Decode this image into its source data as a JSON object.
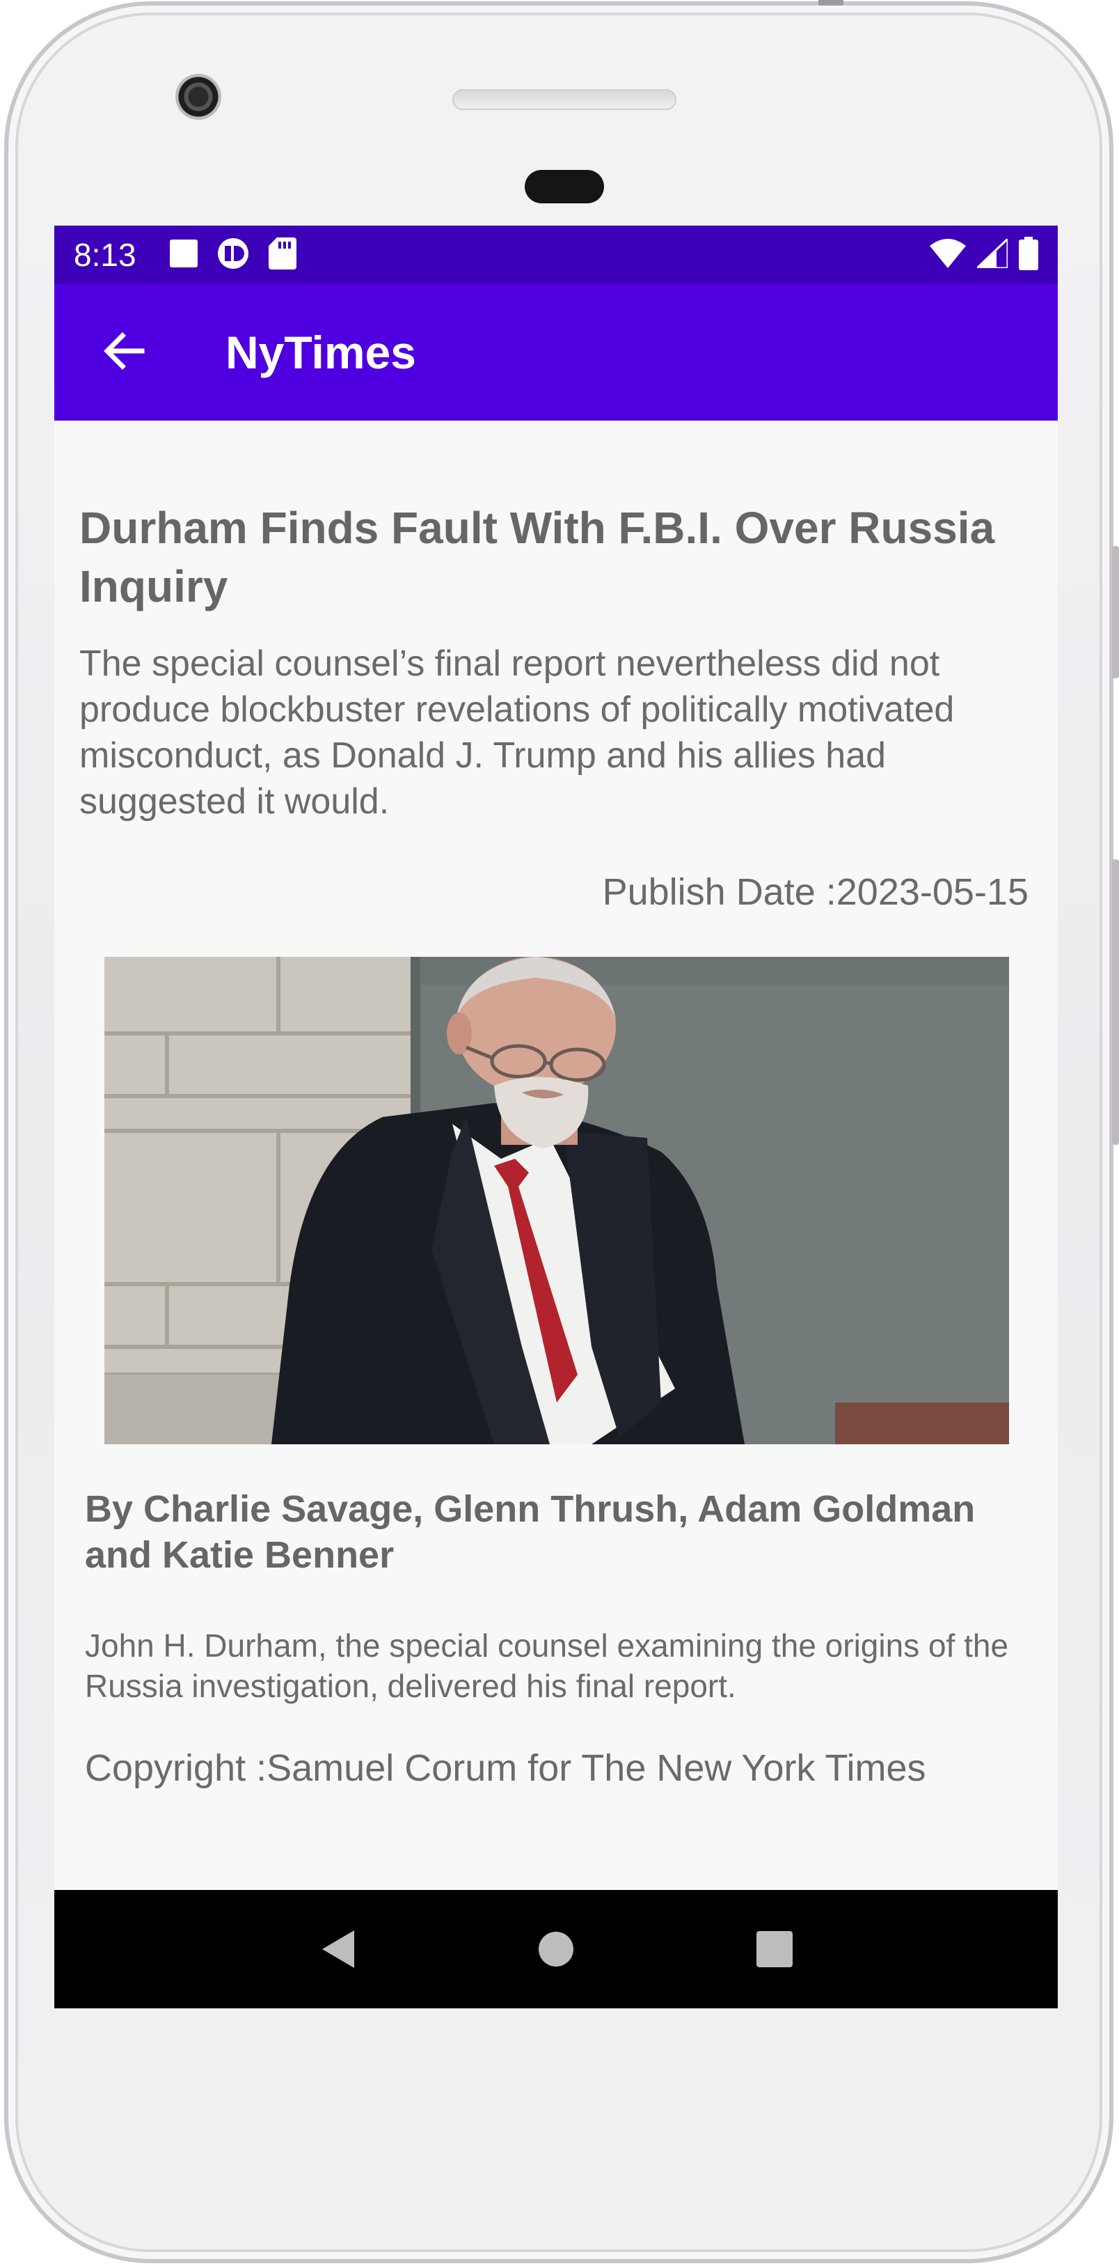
{
  "status_bar": {
    "time": "8:13",
    "left_icons": [
      "stop-square-icon",
      "app-notification-icon",
      "sd-card-icon"
    ],
    "right_icons": [
      "wifi-icon",
      "cellular-signal-icon",
      "battery-icon"
    ]
  },
  "app_bar": {
    "title": "NyTimes",
    "back_icon": "arrow-left-icon"
  },
  "article": {
    "headline": "Durham Finds Fault With F.B.I. Over Russia Inquiry",
    "abstract": "The special counsel’s final report nevertheless did not produce blockbuster revelations of politically motivated misconduct, as Donald J. Trump and his allies had suggested it would.",
    "publish_label": "Publish Date :",
    "publish_date": "2023-05-15",
    "byline": "By Charlie Savage, Glenn Thrush, Adam Goldman and Katie Benner",
    "caption": "John H. Durham, the special counsel examining the origins of the Russia investigation, delivered his final report.",
    "copyright_label": "Copyright :",
    "copyright": "Samuel Corum for The New York Times"
  },
  "nav_bar": {
    "buttons": [
      "back-triangle-icon",
      "home-circle-icon",
      "recents-square-icon"
    ]
  },
  "colors": {
    "status_bar": "#3d00b8",
    "app_bar": "#5000e0",
    "text_gray": "#666666",
    "nav_bar": "#000000"
  }
}
